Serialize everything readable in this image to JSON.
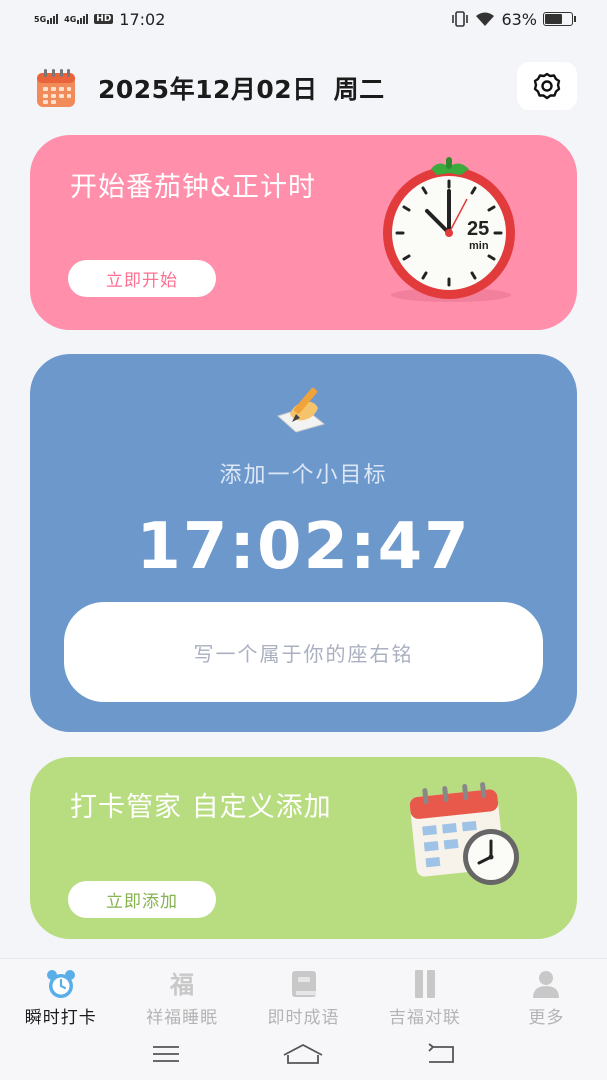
{
  "status": {
    "network1": "5G",
    "network2": "4G",
    "hd": "HD",
    "time": "17:02",
    "battery_percent": "63%",
    "battery_level": 0.63
  },
  "header": {
    "date": "2025年12月02日",
    "weekday": "周二"
  },
  "pomodoro_card": {
    "title": "开始番茄钟&正计时",
    "button": "立即开始",
    "timer_badge": "25",
    "timer_unit": "min",
    "color": "#ff8fab"
  },
  "goal_card": {
    "label": "添加一个小目标",
    "clock": "17:02:47",
    "motto_placeholder": "写一个属于你的座右铭",
    "color": "#6c98cc"
  },
  "checkin_card": {
    "title": "打卡管家 自定义添加",
    "button": "立即添加",
    "color": "#b8dd80"
  },
  "tabbar": {
    "items": [
      {
        "label": "瞬时打卡",
        "icon": "alarm-clock-icon",
        "active": true
      },
      {
        "label": "祥福睡眠",
        "icon": "fu-character-icon",
        "active": false
      },
      {
        "label": "即时成语",
        "icon": "book-icon",
        "active": false
      },
      {
        "label": "吉福对联",
        "icon": "couplet-icon",
        "active": false
      },
      {
        "label": "更多",
        "icon": "person-icon",
        "active": false
      }
    ]
  }
}
